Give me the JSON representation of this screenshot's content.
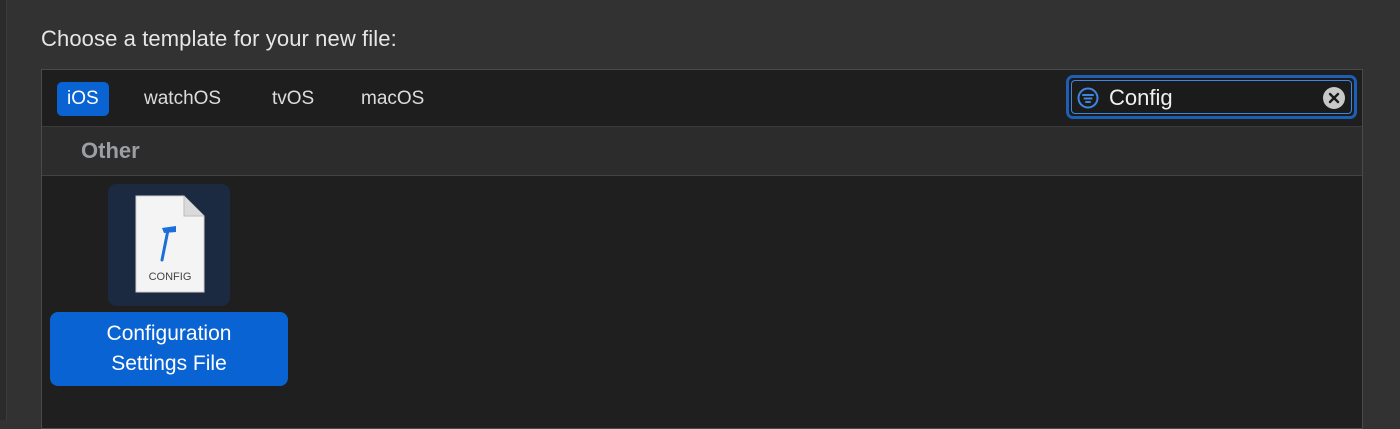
{
  "dialog": {
    "heading": "Choose a template for your new file:"
  },
  "platform_tabs": [
    {
      "label": "iOS",
      "selected": true
    },
    {
      "label": "watchOS",
      "selected": false
    },
    {
      "label": "tvOS",
      "selected": false
    },
    {
      "label": "macOS",
      "selected": false
    }
  ],
  "search": {
    "value": "Config",
    "filter_icon": "filter-icon",
    "clear_icon": "clear-icon"
  },
  "section": {
    "title": "Other"
  },
  "templates": [
    {
      "label_line1": "Configuration",
      "label_line2": "Settings File",
      "icon": "config-file-icon",
      "icon_caption": "CONFIG",
      "selected": true
    }
  ],
  "colors": {
    "accent": "#0a63d2",
    "background": "#323232",
    "panel": "#1f1f1f"
  }
}
